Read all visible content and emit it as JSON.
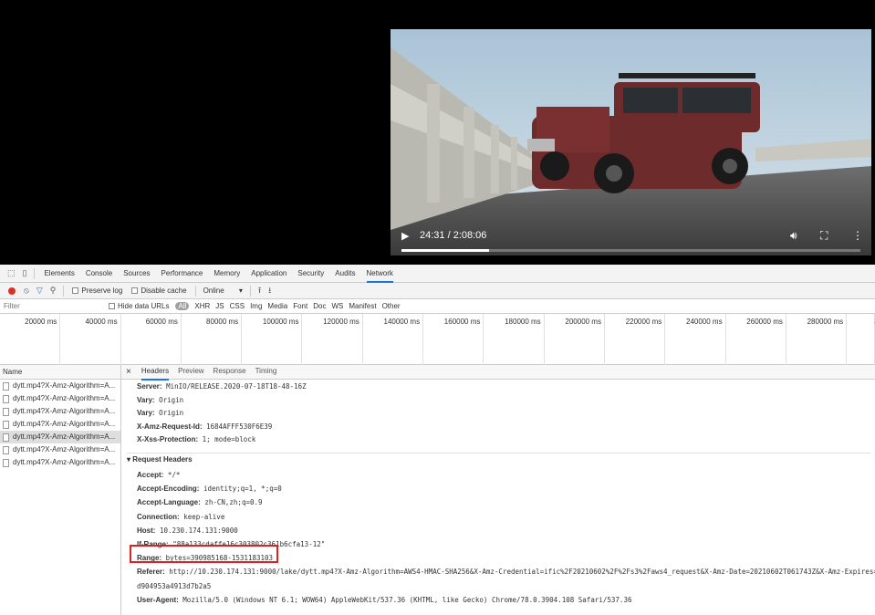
{
  "video": {
    "time": "24:31 / 2:08:06",
    "progress_fraction": 0.191,
    "icons": {
      "play": "play-icon",
      "volume": "volume-icon",
      "fullscreen": "fullscreen-icon",
      "more": "more-vert-icon"
    }
  },
  "devtools": {
    "tabs": [
      "Elements",
      "Console",
      "Sources",
      "Performance",
      "Memory",
      "Application",
      "Security",
      "Audits",
      "Network"
    ],
    "active_tab": "Network",
    "toolbar": {
      "preserve_log": "Preserve log",
      "disable_cache": "Disable cache",
      "throttle": "Online"
    },
    "filter": {
      "placeholder": "Filter",
      "hide_data_urls": "Hide data URLs",
      "types": [
        "All",
        "XHR",
        "JS",
        "CSS",
        "Img",
        "Media",
        "Font",
        "Doc",
        "WS",
        "Manifest",
        "Other"
      ]
    },
    "timeline_ticks": [
      "20000 ms",
      "40000 ms",
      "60000 ms",
      "80000 ms",
      "100000 ms",
      "120000 ms",
      "140000 ms",
      "160000 ms",
      "180000 ms",
      "200000 ms",
      "220000 ms",
      "240000 ms",
      "260000 ms",
      "280000 ms",
      "30"
    ],
    "name_header": "Name",
    "requests": [
      "dytt.mp4?X-Amz-Algorithm=A...",
      "dytt.mp4?X-Amz-Algorithm=A...",
      "dytt.mp4?X-Amz-Algorithm=A...",
      "dytt.mp4?X-Amz-Algorithm=A...",
      "dytt.mp4?X-Amz-Algorithm=A...",
      "dytt.mp4?X-Amz-Algorithm=A...",
      "dytt.mp4?X-Amz-Algorithm=A..."
    ],
    "selected_request_index": 4,
    "detail_tabs": [
      "Headers",
      "Preview",
      "Response",
      "Timing"
    ],
    "close_label": "×",
    "response_headers": [
      {
        "k": "Server:",
        "v": "MinIO/RELEASE.2020-07-18T18-48-16Z"
      },
      {
        "k": "Vary:",
        "v": "Origin"
      },
      {
        "k": "Vary:",
        "v": "Origin"
      },
      {
        "k": "X-Amz-Request-Id:",
        "v": "1684AFFF530F6E39"
      },
      {
        "k": "X-Xss-Protection:",
        "v": "1; mode=block"
      }
    ],
    "request_headers_title": "▾ Request Headers",
    "request_headers": [
      {
        "k": "Accept:",
        "v": "*/*"
      },
      {
        "k": "Accept-Encoding:",
        "v": "identity;q=1, *;q=0"
      },
      {
        "k": "Accept-Language:",
        "v": "zh-CN,zh;q=0.9"
      },
      {
        "k": "Connection:",
        "v": "keep-alive"
      },
      {
        "k": "Host:",
        "v": "10.230.174.131:9000"
      },
      {
        "k": "If-Range:",
        "v": "\"88a133cdaffe16c303802c361b6cfa13-12\""
      },
      {
        "k": "Range:",
        "v": "bytes=390985168-1531183103"
      },
      {
        "k": "Referer:",
        "v": "http://10.230.174.131:9000/lake/dytt.mp4?X-Amz-Algorithm=AWS4-HMAC-SHA256&X-Amz-Credential=ific%2F20210602%2F%2Fs3%2Faws4_request&X-Amz-Date=20210602T061743Z&X-Amz-Expires=43"
      },
      {
        "k": "",
        "v": "d904953a4913d7b2a5"
      },
      {
        "k": "User-Agent:",
        "v": "Mozilla/5.0 (Windows NT 6.1; WOW64) AppleWebKit/537.36 (KHTML, like Gecko) Chrome/78.0.3904.108 Safari/537.36"
      }
    ]
  }
}
